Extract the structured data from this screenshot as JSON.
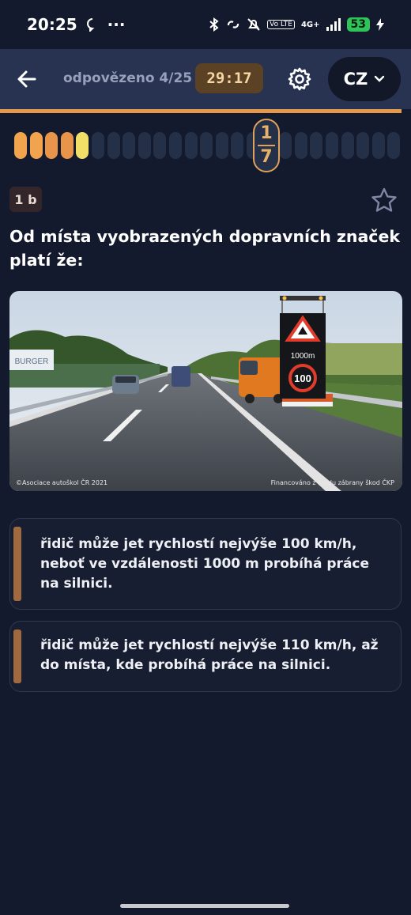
{
  "status_bar": {
    "time": "20:25",
    "dots": "···",
    "battery": "53",
    "network": "4G+",
    "volte": "Vo LTE"
  },
  "header": {
    "answered": "odpovězeno 4/25",
    "timer": "29:17",
    "language": "CZ"
  },
  "progress": {
    "total": 25,
    "answered_colors": [
      "#f2a34d",
      "#f2a34d",
      "#e8944a",
      "#e8944a",
      "#f2df68"
    ],
    "current_number": "17",
    "current_digit_top": "1",
    "current_digit_bottom": "7"
  },
  "question": {
    "points": "1 b",
    "text": "Od místa vyobrazených dopravních značek platí že:",
    "image_credit_left": "©Asociace autoškol ČR 2021",
    "image_credit_right": "Financováno z fondu zábrany škod ČKP",
    "sign_distance": "1000m",
    "sign_speed": "100",
    "billboard_text": "BURGER"
  },
  "answers": [
    {
      "text": "řidič může jet rychlostí nejvýše 100 km/h, neboť ve vzdálenosti 1000 m probíhá práce na silnici."
    },
    {
      "text": "řidič může jet rychlostí nejvýše 110 km/h, až do místa, kde probíhá práce na silnici."
    }
  ],
  "colors": {
    "accent": "#e49a4c",
    "background": "#141a2d",
    "header": "#283352"
  },
  "icons": [
    "back-arrow-icon",
    "gear-icon",
    "chevron-down-icon",
    "star-icon"
  ]
}
